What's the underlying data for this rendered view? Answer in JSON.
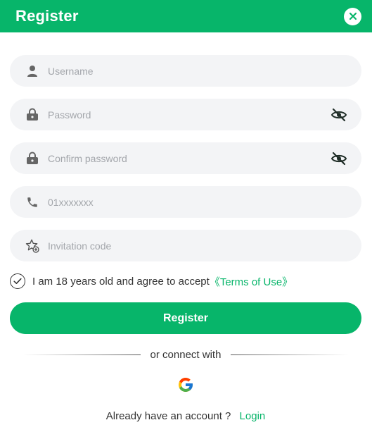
{
  "header": {
    "title": "Register"
  },
  "fields": {
    "username": {
      "placeholder": "Username",
      "icon": "user-icon"
    },
    "password": {
      "placeholder": "Password",
      "icon": "lock-icon"
    },
    "confirm_password": {
      "placeholder": "Confirm password",
      "icon": "lock-icon"
    },
    "phone": {
      "placeholder": "01xxxxxxx",
      "icon": "phone-icon"
    },
    "invitation": {
      "placeholder": "Invitation code",
      "icon": "star-plus-icon"
    }
  },
  "agreement": {
    "text": "I am 18 years old and agree to accept",
    "terms_link": "《Terms of Use》",
    "checked": true
  },
  "submit_label": "Register",
  "divider_text": "or connect with",
  "login": {
    "question": "Already have an account ?",
    "link": "Login"
  },
  "colors": {
    "accent": "#07b56a",
    "field_bg": "#f3f4f6",
    "placeholder": "#a3a6ab"
  }
}
